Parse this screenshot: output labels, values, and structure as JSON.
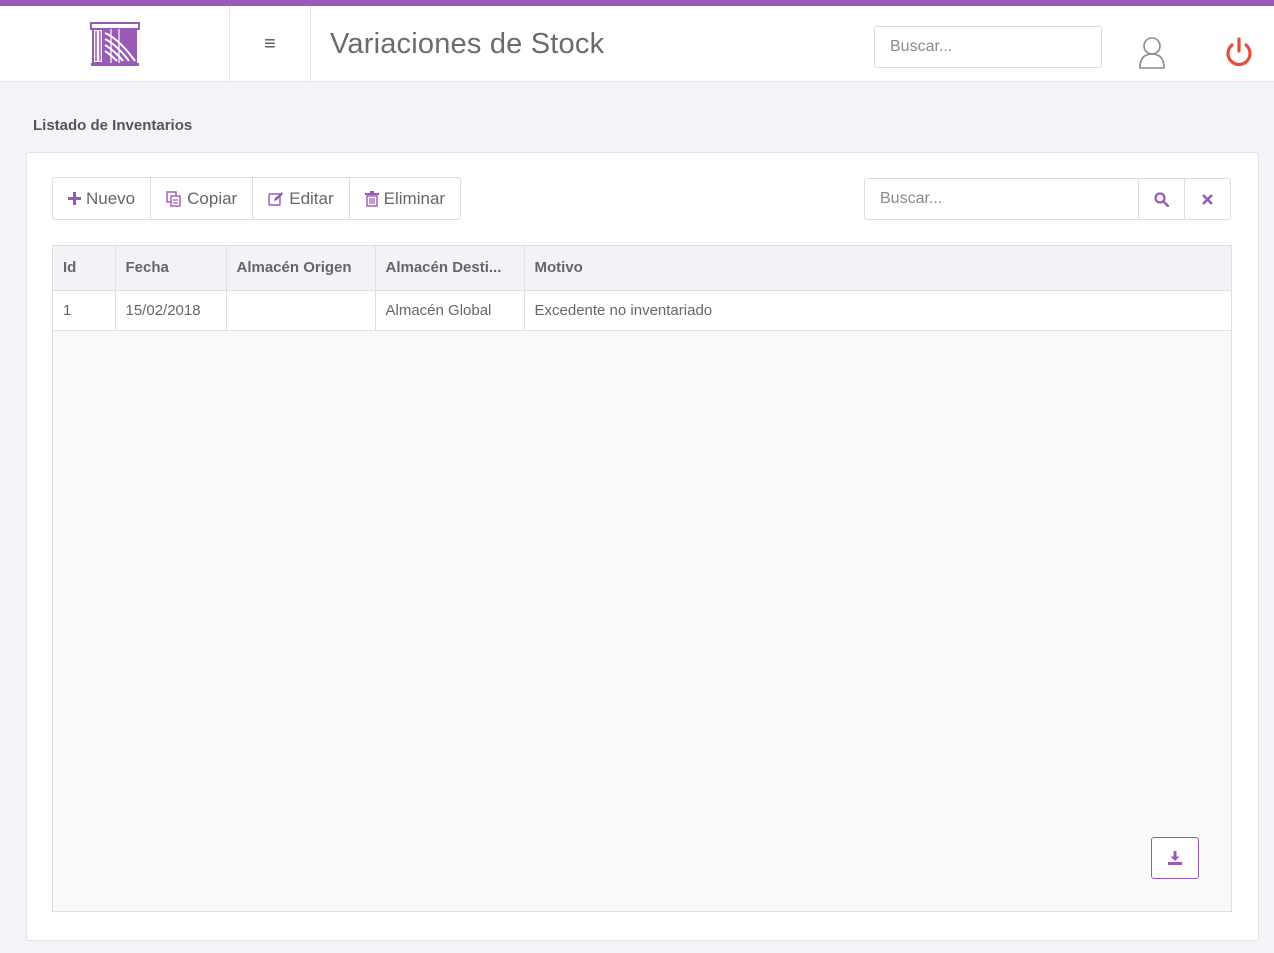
{
  "header": {
    "title": "Variaciones de Stock",
    "search_placeholder": "Buscar...",
    "logo_icon": "warehouse-logo-icon",
    "menu_icon": "≡",
    "user_icon": "user-icon",
    "power_icon": "power-icon"
  },
  "section": {
    "label": "Listado de Inventarios"
  },
  "toolbar": {
    "new_label": "Nuevo",
    "copy_label": "Copiar",
    "edit_label": "Editar",
    "delete_label": "Eliminar"
  },
  "search": {
    "placeholder": "Buscar..."
  },
  "table": {
    "columns": [
      "Id",
      "Fecha",
      "Almacén Origen",
      "Almacén Desti...",
      "Motivo"
    ],
    "rows": [
      [
        "1",
        "15/02/2018",
        "",
        "Almacén Global",
        "Excedente no inventariado"
      ]
    ]
  },
  "colors": {
    "accent": "#9a59b5",
    "power": "#e74c3c",
    "background": "#f3f4f7"
  }
}
